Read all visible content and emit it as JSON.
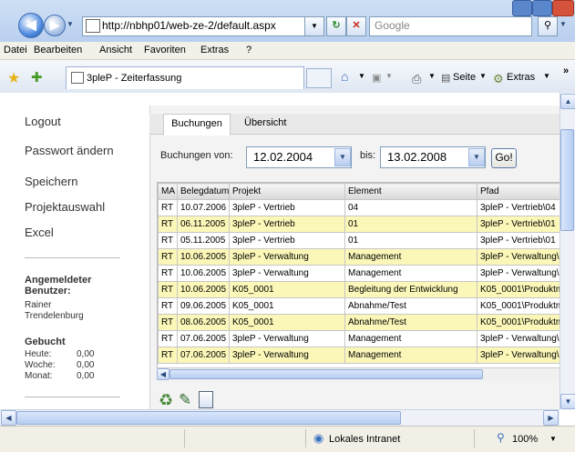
{
  "browser": {
    "url": "http://nbhp01/web-ze-2/default.aspx",
    "search_placeholder": "Google",
    "menu": [
      "Datei",
      "Bearbeiten",
      "Ansicht",
      "Favoriten",
      "Extras",
      "?"
    ],
    "tab_title": "3pleP - Zeiterfassung",
    "toolbar": {
      "seite": "Seite",
      "extras": "Extras"
    },
    "status": {
      "zone": "Lokales Intranet",
      "zoom": "100%"
    }
  },
  "sidebar": {
    "links": [
      "Logout",
      "Passwort ändern",
      "Speichern",
      "Projektauswahl",
      "Excel"
    ],
    "user_heading": "Angemeldeter Benutzer:",
    "user_name": "Rainer Trendelenburg",
    "booked_heading": "Gebucht",
    "booked": [
      {
        "label": "Heute:",
        "value": "0,00"
      },
      {
        "label": "Woche:",
        "value": "0,00"
      },
      {
        "label": "Monat:",
        "value": "0,00"
      }
    ]
  },
  "main": {
    "tabs": [
      "Buchungen",
      "Übersicht"
    ],
    "filter": {
      "from_label": "Buchungen von:",
      "from_value": "12.02.2004",
      "to_label": "bis:",
      "to_value": "13.02.2008",
      "go_label": "Go!"
    },
    "table": {
      "columns": [
        "MA",
        "Belegdatum",
        "Projekt",
        "Element",
        "Pfad"
      ],
      "rows": [
        {
          "cells": [
            "RT",
            "10.07.2006",
            "3pleP - Vertrieb",
            "04",
            "3pleP - Vertrieb\\04"
          ],
          "highlight": false
        },
        {
          "cells": [
            "RT",
            "06.11.2005",
            "3pleP - Vertrieb",
            "01",
            "3pleP - Vertrieb\\01"
          ],
          "highlight": true
        },
        {
          "cells": [
            "RT",
            "05.11.2005",
            "3pleP - Vertrieb",
            "01",
            "3pleP - Vertrieb\\01"
          ],
          "highlight": false
        },
        {
          "cells": [
            "RT",
            "10.06.2005",
            "3pleP - Verwaltung",
            "Management",
            "3pleP - Verwaltung\\"
          ],
          "highlight": true
        },
        {
          "cells": [
            "RT",
            "10.06.2005",
            "3pleP - Verwaltung",
            "Management",
            "3pleP - Verwaltung\\"
          ],
          "highlight": false
        },
        {
          "cells": [
            "RT",
            "10.06.2005",
            "K05_0001",
            "Begleitung der Entwicklung",
            "K05_0001\\Produktm"
          ],
          "highlight": true
        },
        {
          "cells": [
            "RT",
            "09.06.2005",
            "K05_0001",
            "Abnahme/Test",
            "K05_0001\\Produktm"
          ],
          "highlight": false
        },
        {
          "cells": [
            "RT",
            "08.06.2005",
            "K05_0001",
            "Abnahme/Test",
            "K05_0001\\Produktm"
          ],
          "highlight": true
        },
        {
          "cells": [
            "RT",
            "07.06.2005",
            "3pleP - Verwaltung",
            "Management",
            "3pleP - Verwaltung\\"
          ],
          "highlight": false
        },
        {
          "cells": [
            "RT",
            "07.06.2005",
            "3pleP - Verwaltung",
            "Management",
            "3pleP - Verwaltung\\"
          ],
          "highlight": true
        }
      ]
    }
  }
}
